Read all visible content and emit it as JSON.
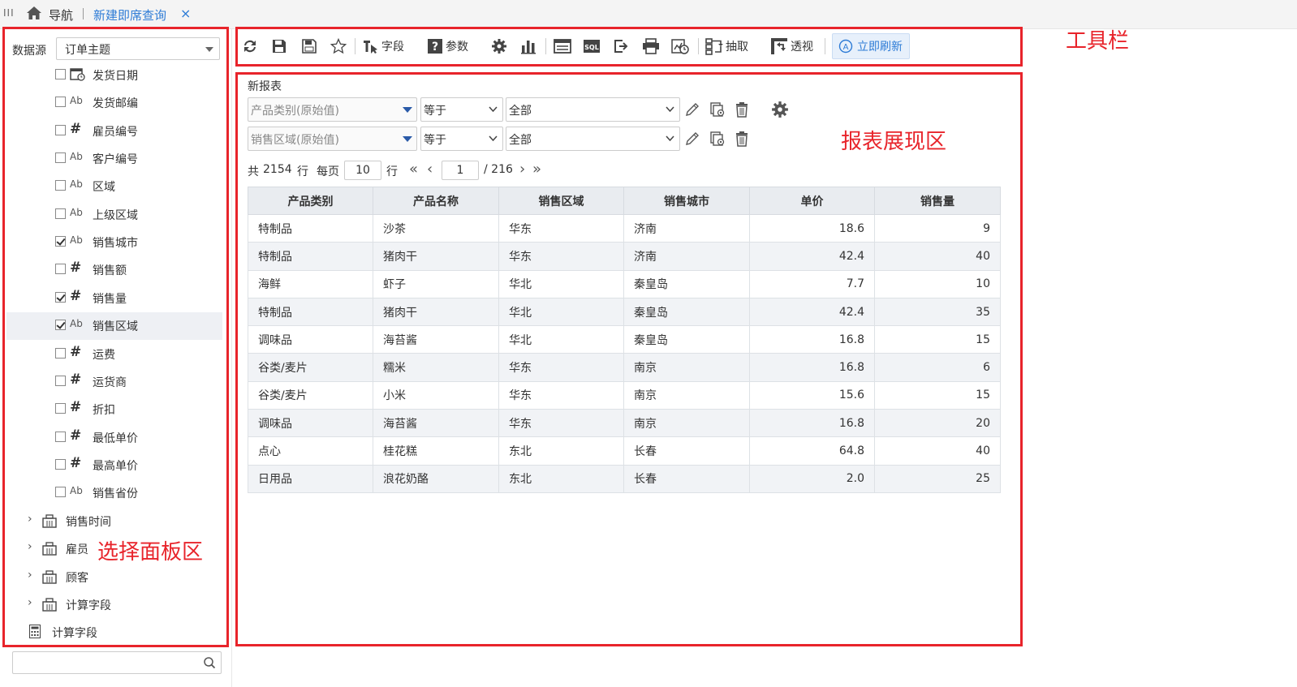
{
  "topbar": {
    "nav_label": "导航",
    "tab_label": "新建即席查询",
    "tab_close": "×",
    "menu_glyph": "III"
  },
  "left": {
    "datasource_label": "数据源",
    "datasource_value": "订单主题",
    "fields": [
      {
        "label": "发货日期",
        "type": "date",
        "checked": false
      },
      {
        "label": "发货邮编",
        "type": "text",
        "checked": false
      },
      {
        "label": "雇员编号",
        "type": "number",
        "checked": false
      },
      {
        "label": "客户编号",
        "type": "text",
        "checked": false
      },
      {
        "label": "区域",
        "type": "text",
        "checked": false
      },
      {
        "label": "上级区域",
        "type": "text",
        "checked": false
      },
      {
        "label": "销售城市",
        "type": "text",
        "checked": true
      },
      {
        "label": "销售额",
        "type": "number",
        "checked": false
      },
      {
        "label": "销售量",
        "type": "number",
        "checked": true
      },
      {
        "label": "销售区域",
        "type": "text",
        "checked": true,
        "selected": true
      },
      {
        "label": "运费",
        "type": "number",
        "checked": false
      },
      {
        "label": "运货商",
        "type": "number",
        "checked": false
      },
      {
        "label": "折扣",
        "type": "number",
        "checked": false
      },
      {
        "label": "最低单价",
        "type": "number",
        "checked": false
      },
      {
        "label": "最高单价",
        "type": "number",
        "checked": false
      },
      {
        "label": "销售省份",
        "type": "text",
        "checked": false
      }
    ],
    "groups": [
      "销售时间",
      "雇员",
      "顾客",
      "计算字段"
    ],
    "calc_item": "计算字段",
    "annotation": "选择面板区"
  },
  "toolbar": {
    "field_label": "字段",
    "param_label": "参数",
    "extract_label": "抽取",
    "pivot_label": "透视",
    "refresh_label": "立即刷新",
    "annotation": "工具栏"
  },
  "report": {
    "title": "新报表",
    "annotation": "报表展现区",
    "filters": [
      {
        "field": "产品类别(原始值)",
        "op": "等于",
        "value": "全部"
      },
      {
        "field": "销售区域(原始值)",
        "op": "等于",
        "value": "全部"
      }
    ],
    "pager": {
      "total_prefix": "共",
      "total": "2154",
      "total_unit": "行",
      "per_page_label": "每页",
      "per_page": "10",
      "per_page_unit": "行",
      "current": "1",
      "pages": "/ 216"
    },
    "columns": [
      "产品类别",
      "产品名称",
      "销售区域",
      "销售城市",
      "单价",
      "销售量"
    ],
    "rows": [
      [
        "特制品",
        "沙茶",
        "华东",
        "济南",
        "18.6",
        "9"
      ],
      [
        "特制品",
        "猪肉干",
        "华东",
        "济南",
        "42.4",
        "40"
      ],
      [
        "海鲜",
        "虾子",
        "华北",
        "秦皇岛",
        "7.7",
        "10"
      ],
      [
        "特制品",
        "猪肉干",
        "华北",
        "秦皇岛",
        "42.4",
        "35"
      ],
      [
        "调味品",
        "海苔酱",
        "华北",
        "秦皇岛",
        "16.8",
        "15"
      ],
      [
        "谷类/麦片",
        "糯米",
        "华东",
        "南京",
        "16.8",
        "6"
      ],
      [
        "谷类/麦片",
        "小米",
        "华东",
        "南京",
        "15.6",
        "15"
      ],
      [
        "调味品",
        "海苔酱",
        "华东",
        "南京",
        "16.8",
        "20"
      ],
      [
        "点心",
        "桂花糕",
        "东北",
        "长春",
        "64.8",
        "40"
      ],
      [
        "日用品",
        "浪花奶酪",
        "东北",
        "长春",
        "2.0",
        "25"
      ]
    ]
  },
  "colors": {
    "accent": "#2d7bd6",
    "annotation_red": "#e8242b",
    "header_bg": "#e9ecf0"
  }
}
